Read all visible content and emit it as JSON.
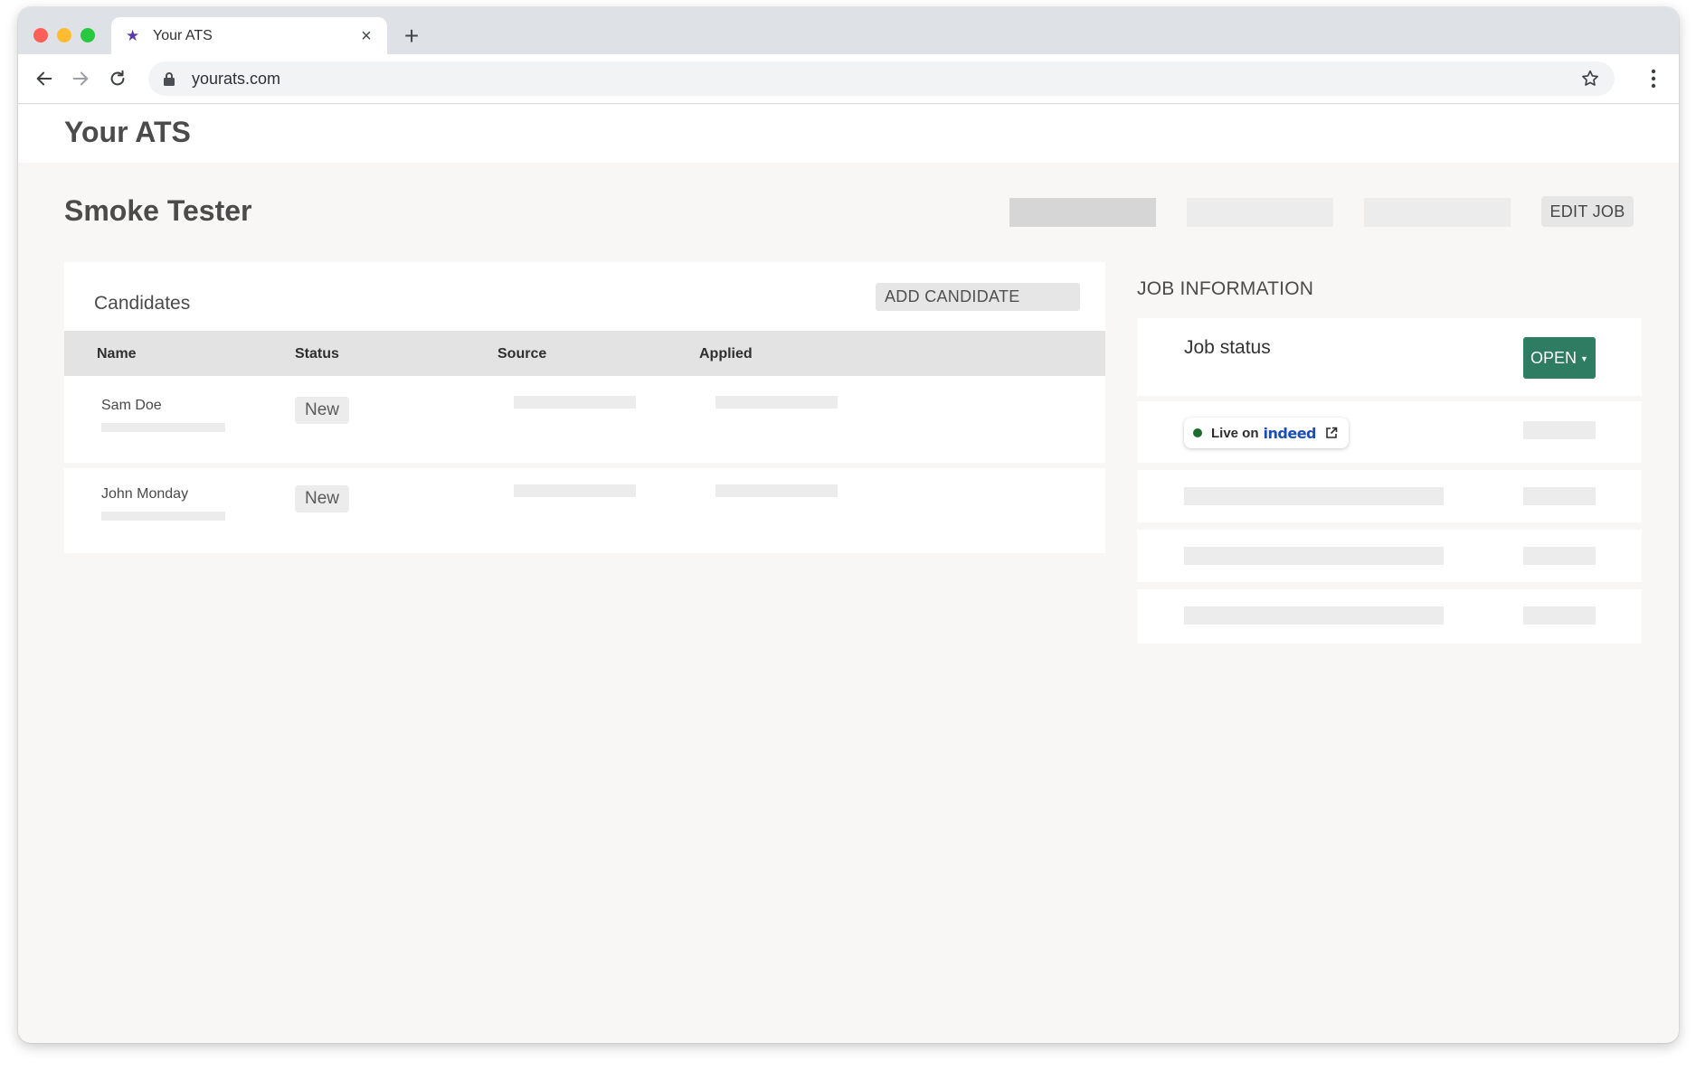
{
  "browser": {
    "tab_title": "Your ATS",
    "url": "yourats.com"
  },
  "app": {
    "title": "Your ATS"
  },
  "job": {
    "title": "Smoke Tester",
    "edit_label": "EDIT JOB"
  },
  "candidates": {
    "title": "Candidates",
    "add_label": "ADD CANDIDATE",
    "columns": [
      "Name",
      "Status",
      "Source",
      "Applied"
    ],
    "rows": [
      {
        "name": "Sam Doe",
        "status": "New"
      },
      {
        "name": "John Monday",
        "status": "New"
      }
    ]
  },
  "job_information": {
    "title": "JOB INFORMATION",
    "status_label": "Job status",
    "status_value": "OPEN",
    "live_label": "Live on",
    "live_brand": "indeed"
  },
  "colors": {
    "accent_green": "#2e7d62",
    "live_dot": "#1d6b2f",
    "indeed_blue": "#1c4eb8"
  }
}
